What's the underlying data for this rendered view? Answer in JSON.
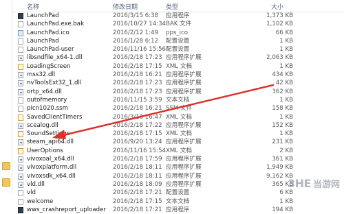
{
  "header": {
    "name": "名称",
    "date": "修改日期",
    "type": "类型",
    "size": "大小"
  },
  "files": [
    {
      "name": "LaunchPad",
      "date": "2016/3/15 6:38",
      "type": "应用程序",
      "size": "1,373 KB",
      "icon": "exe-icon"
    },
    {
      "name": "LaunchPad.exe.bak",
      "date": "2016/10/27 14:34",
      "type": "BAK 文件",
      "size": "1,102 KB",
      "icon": "bak-file-icon"
    },
    {
      "name": "LaunchPad.ico",
      "date": "2016/2/12 1:49",
      "type": "pps_ico",
      "size": "66 KB",
      "icon": "image-file-icon"
    },
    {
      "name": "LaunchPad",
      "date": "2016/1/28 6:12",
      "type": "配置设置",
      "size": "1 KB",
      "icon": "config-file-icon"
    },
    {
      "name": "LaunchPad-user",
      "date": "2016/11/16 15:56",
      "type": "配置设置",
      "size": "1 KB",
      "icon": "config-file-icon"
    },
    {
      "name": "libsndfile_x64-1.dll",
      "date": "2016/2/18 17:23",
      "type": "应用程序扩展",
      "size": "2,063 KB",
      "icon": "dll-file-icon"
    },
    {
      "name": "LoadingScreen",
      "date": "2016/2/18 17:15",
      "type": "XML 文档",
      "size": "1 KB",
      "icon": "xml-file-icon"
    },
    {
      "name": "mss32.dll",
      "date": "2016/2/18 16:21",
      "type": "应用程序扩展",
      "size": "434 KB",
      "icon": "dll-file-icon"
    },
    {
      "name": "nvToolsExt32_1.dll",
      "date": "2016/2/18 17:23",
      "type": "应用程序扩展",
      "size": "42 KB",
      "icon": "dll-file-icon"
    },
    {
      "name": "ortp_x64.dll",
      "date": "2016/2/18 17:23",
      "type": "应用程序扩展",
      "size": "362 KB",
      "icon": "dll-file-icon"
    },
    {
      "name": "outofmemory",
      "date": "2016/11/15 3:59",
      "type": "文本文档",
      "size": "1 KB",
      "icon": "text-file-icon"
    },
    {
      "name": "picn1020.ssm",
      "date": "2016/2/18 16:21",
      "type": "SSM 文件",
      "size": "158 KB",
      "icon": "ssm-file-icon"
    },
    {
      "name": "SavedClientTimers",
      "date": "2016/3/10 16:47",
      "type": "XML 文档",
      "size": "1 KB",
      "icon": "xml-file-icon"
    },
    {
      "name": "scealog.dll",
      "date": "2016/2/18 17:22",
      "type": "应用程序扩展",
      "size": "152 KB",
      "icon": "dll-file-icon"
    },
    {
      "name": "SoundSettings",
      "date": "2016/2/18 17:15",
      "type": "XML 文档",
      "size": "1 KB",
      "icon": "xml-file-icon"
    },
    {
      "name": "steam_api64.dll",
      "date": "2016/9/20 13:24",
      "type": "应用程序扩展",
      "size": "231 KB",
      "icon": "dll-file-icon"
    },
    {
      "name": "UserOptions",
      "date": "2016/11/16 15:54",
      "type": "XML 文档",
      "size": "2 KB",
      "icon": "xml-file-icon"
    },
    {
      "name": "vivoxoal_x64.dll",
      "date": "2016/2/18 17:59",
      "type": "应用程序扩展",
      "size": "361 KB",
      "icon": "dll-file-icon"
    },
    {
      "name": "vivoxplatform.dll",
      "date": "2016/2/18 18:11",
      "type": "应用程序扩展",
      "size": "1,949 KB",
      "icon": "dll-file-icon"
    },
    {
      "name": "vivoxsdk_x64.dll",
      "date": "2016/2/18 18:11",
      "type": "应用程序扩展",
      "size": "9,162 KB",
      "icon": "dll-file-icon"
    },
    {
      "name": "vld.dll",
      "date": "2016/2/18 18:09",
      "type": "应用程序扩展",
      "size": "365 KB",
      "icon": "dll-file-icon"
    },
    {
      "name": "vld",
      "date": "2016/2/18 17:21",
      "type": "配置设置",
      "size": "6 KB",
      "icon": "config-file-icon"
    },
    {
      "name": "welcome",
      "date": "2016/2/18 17:15",
      "type": "文本文档",
      "size": "1 KB",
      "icon": "text-file-icon"
    },
    {
      "name": "wws_crashreport_uploader",
      "date": "2016/2/18 17:21",
      "type": "应用程序",
      "size": "194 KB",
      "icon": "exe-icon"
    }
  ],
  "watermark": {
    "brand": "3HE",
    "site": "当游网"
  },
  "colors": {
    "arrow": "#e0302a",
    "header_text": "#4c607a"
  }
}
